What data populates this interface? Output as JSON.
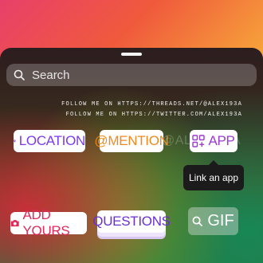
{
  "search": {
    "placeholder": "Search",
    "value": ""
  },
  "watermark": {
    "line1": "FOLLOW ME ON HTTPS://THREADS.NET/@ALEX193A",
    "line2": "FOLLOW ME ON HTTPS://TWITTER.COM/ALEX193A",
    "ghost": "@ALEX193A"
  },
  "stickers": {
    "location": {
      "label": "LOCATION",
      "icon": "location-pin-icon",
      "color": "#7c3aed"
    },
    "mention": {
      "label": "@MENTION",
      "color": "#f08a1d"
    },
    "app": {
      "label": "APP",
      "icon": "apps-grid-icon",
      "color": "#9b3bd1"
    },
    "add_yours": {
      "label": "ADD YOURS",
      "icon": "camera-icon",
      "color": "#e0295a"
    },
    "questions": {
      "label": "QUESTIONS",
      "color": "#6b2fd1"
    },
    "gif": {
      "label": "GIF",
      "icon": "search-icon"
    }
  },
  "tooltip": {
    "text": "Link an app"
  }
}
